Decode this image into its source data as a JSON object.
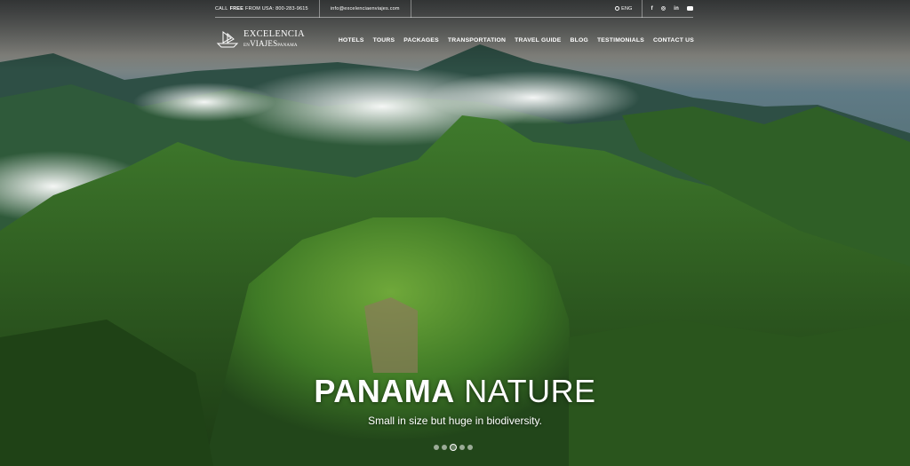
{
  "topbar": {
    "call_prefix": "CALL",
    "call_free": "FREE",
    "call_suffix": "FROM USA: 800-283-9615",
    "email": "info@excelenciaenviajes.com",
    "lang": "ENG",
    "social": {
      "facebook": "f",
      "instagram": "◎",
      "linkedin": "in"
    }
  },
  "logo": {
    "line1": "EXCELENCIA",
    "line2_small": "EN",
    "line2": "VIAJES",
    "line2_end": "PANAMA"
  },
  "nav": {
    "items": [
      "HOTELS",
      "TOURS",
      "PACKAGES",
      "TRANSPORTATION",
      "TRAVEL GUIDE",
      "BLOG",
      "TESTIMONIALS",
      "CONTACT US"
    ]
  },
  "hero": {
    "title_bold": "PANAMA",
    "title_light": " NATURE",
    "subtitle": "Small in size but huge in biodiversity."
  },
  "slider": {
    "count": 5,
    "active_index": 3
  },
  "colors": {
    "forest": "#2f5a22",
    "sky": "#6f7a7a"
  }
}
